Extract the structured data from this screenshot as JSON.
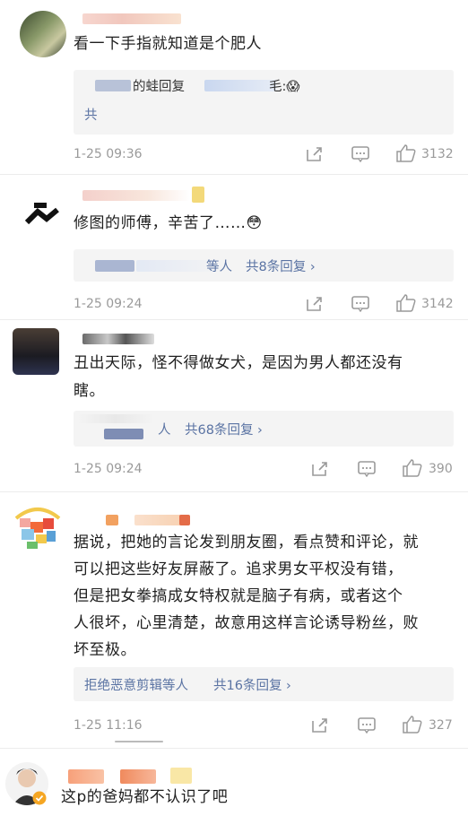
{
  "comments": [
    {
      "text": "看一下手指就知道是个肥人",
      "reply_line1": "的蛙回复",
      "reply_line1b": "毛:😱",
      "reply_line2": "共",
      "time": "1-25 09:36",
      "likes": "3132"
    },
    {
      "text": "修图的师傅，辛苦了……😳",
      "reply_summary": "等人",
      "reply_count": "共8条回复 ›",
      "time": "1-25 09:24",
      "likes": "3142"
    },
    {
      "text_line1": "丑出天际，怪不得做女犬，是因为男人都还没有",
      "text_line2": "瞎。",
      "reply_summary": "人",
      "reply_count": "共68条回复 ›",
      "time": "1-25 09:24",
      "likes": "390"
    },
    {
      "text_line1": "据说，把她的言论发到朋友圈，看点赞和评论，就",
      "text_line2": "可以把这些好友屏蔽了。追求男女平权没有错，",
      "text_line3": "但是把女拳搞成女特权就是脑子有病，或者这个",
      "text_line4": "人很坏，心里清楚，故意用这样言论诱导粉丝，败",
      "text_line5": "坏至极。",
      "reply_summary": "拒绝恶意剪辑等人",
      "reply_count": "共16条回复 ›",
      "time": "1-25 11:16",
      "likes": "327"
    },
    {
      "text": "这p的爸妈都不认识了吧"
    }
  ],
  "icons": [
    "share-icon",
    "comment-icon",
    "like-icon"
  ],
  "colors": {
    "link": "#5a73a3",
    "meta": "#9a9a9a",
    "reply_bg": "#f4f4f4"
  }
}
